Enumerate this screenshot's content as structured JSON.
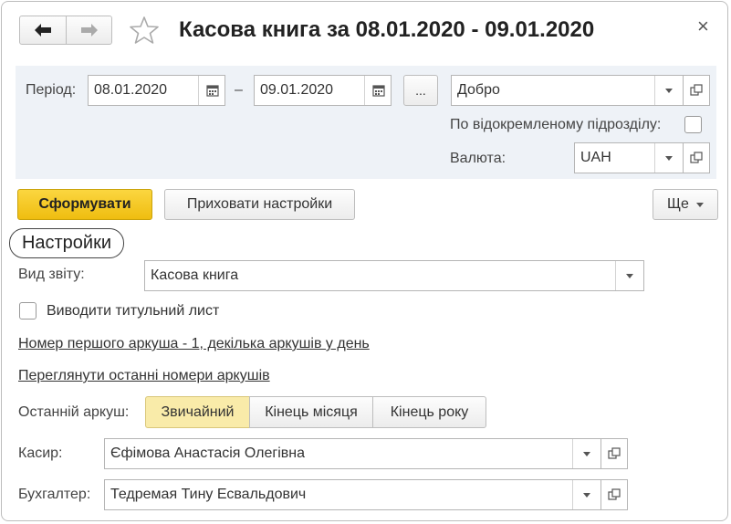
{
  "header": {
    "title": "Касова книга за 08.01.2020 - 09.01.2020",
    "back_icon": "arrow-left-icon",
    "forward_icon": "arrow-right-icon",
    "favorite_icon": "star-icon",
    "close_label": "×"
  },
  "period": {
    "label": "Період:",
    "from": "08.01.2020",
    "dash": "–",
    "to": "09.01.2020",
    "more_label": "..."
  },
  "organization": {
    "value": "Добро"
  },
  "subdivision": {
    "label": "По відокремленому підрозділу:",
    "checked": false
  },
  "currency": {
    "label": "Валюта:",
    "value": "UAH"
  },
  "actions": {
    "generate": "Сформувати",
    "hide_settings": "Приховати настройки",
    "more": "Ще"
  },
  "settings": {
    "title": "Настройки",
    "report_type_label": "Вид звіту:",
    "report_type_value": "Касова книга",
    "title_page_label": "Виводити титульний лист",
    "title_page_checked": false,
    "sheet_link": "Номер першого аркуша - 1, декілька аркушів у день",
    "view_numbers_link": "Переглянути останні номери аркушів",
    "last_sheet_label": "Останній аркуш:",
    "last_sheet_options": [
      "Звичайний",
      "Кінець місяця",
      "Кінець року"
    ],
    "last_sheet_selected": "Звичайний",
    "cashier_label": "Касир:",
    "cashier_value": "Єфімова Анастасія Олегівна",
    "accountant_label": "Бухгалтер:",
    "accountant_value": "Тедремая Тину Есвальдович"
  },
  "colors": {
    "accent": "#f5c518",
    "panel_bg": "#eef2f7",
    "selected_option_bg": "#f9eba9"
  }
}
